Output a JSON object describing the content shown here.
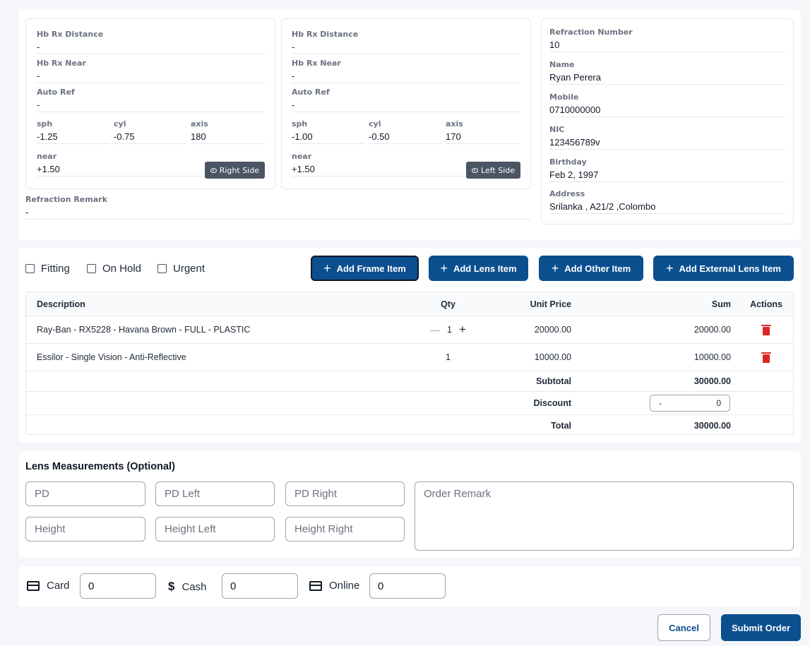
{
  "right_eye": {
    "hb_rx_distance": {
      "label": "Hb Rx Distance",
      "value": "-"
    },
    "hb_rx_near": {
      "label": "Hb Rx Near",
      "value": "-"
    },
    "auto_ref": {
      "label": "Auto Ref",
      "value": "-"
    },
    "sph": {
      "label": "sph",
      "value": "-1.25"
    },
    "cyl": {
      "label": "cyl",
      "value": "-0.75"
    },
    "axis": {
      "label": "axis",
      "value": "180"
    },
    "near": {
      "label": "near",
      "value": "+1.50"
    },
    "button": "Right Side"
  },
  "left_eye": {
    "hb_rx_distance": {
      "label": "Hb Rx Distance",
      "value": "-"
    },
    "hb_rx_near": {
      "label": "Hb Rx Near",
      "value": "-"
    },
    "auto_ref": {
      "label": "Auto Ref",
      "value": "-"
    },
    "sph": {
      "label": "sph",
      "value": "-1.00"
    },
    "cyl": {
      "label": "cyl",
      "value": "-0.50"
    },
    "axis": {
      "label": "axis",
      "value": "170"
    },
    "near": {
      "label": "near",
      "value": "+1.50"
    },
    "button": "Left Side"
  },
  "refraction_remark": {
    "label": "Refraction Remark",
    "value": "-"
  },
  "patient": {
    "refraction_number": {
      "label": "Refraction Number",
      "value": "10"
    },
    "name": {
      "label": "Name",
      "value": "Ryan Perera"
    },
    "mobile": {
      "label": "Mobile",
      "value": "0710000000"
    },
    "nic": {
      "label": "NIC",
      "value": "123456789v"
    },
    "birthday": {
      "label": "Birthday",
      "value": "Feb 2, 1997"
    },
    "address": {
      "label": "Address",
      "value": "Srilanka , A21/2 ,Colombo"
    }
  },
  "flags": {
    "fitting": "Fitting",
    "on_hold": "On Hold",
    "urgent": "Urgent"
  },
  "actions": {
    "add_frame": "Add Frame Item",
    "add_lens": "Add Lens Item",
    "add_other": "Add Other Item",
    "add_external_lens": "Add External Lens Item"
  },
  "table": {
    "headers": {
      "description": "Description",
      "qty": "Qty",
      "unit_price": "Unit Price",
      "sum": "Sum",
      "actions": "Actions"
    },
    "rows": [
      {
        "description": "Ray-Ban - RX5228 - Havana Brown - FULL - PLASTIC",
        "qty": "1",
        "unit_price": "20000.00",
        "sum": "20000.00"
      },
      {
        "description": "Essilor - Single Vision - Anti-Reflective",
        "qty": "1",
        "unit_price": "10000.00",
        "sum": "10000.00"
      }
    ],
    "subtotal_label": "Subtotal",
    "subtotal_value": "30000.00",
    "discount_label": "Discount",
    "discount_sign": "-",
    "discount_value": "0",
    "total_label": "Total",
    "total_value": "30000.00"
  },
  "lens": {
    "title": "Lens Measurements (Optional)",
    "pd": "PD",
    "pd_left": "PD Left",
    "pd_right": "PD Right",
    "height": "Height",
    "height_left": "Height Left",
    "height_right": "Height Right",
    "order_remark": "Order Remark"
  },
  "payment": {
    "card_label": "Card",
    "card_value": "0",
    "cash_label": "Cash",
    "cash_value": "0",
    "online_label": "Online",
    "online_value": "0"
  },
  "footer": {
    "cancel": "Cancel",
    "submit": "Submit Order"
  },
  "colors": {
    "primary": "#0b4f8f",
    "danger": "#dc2626",
    "side_button": "#4b5563"
  }
}
